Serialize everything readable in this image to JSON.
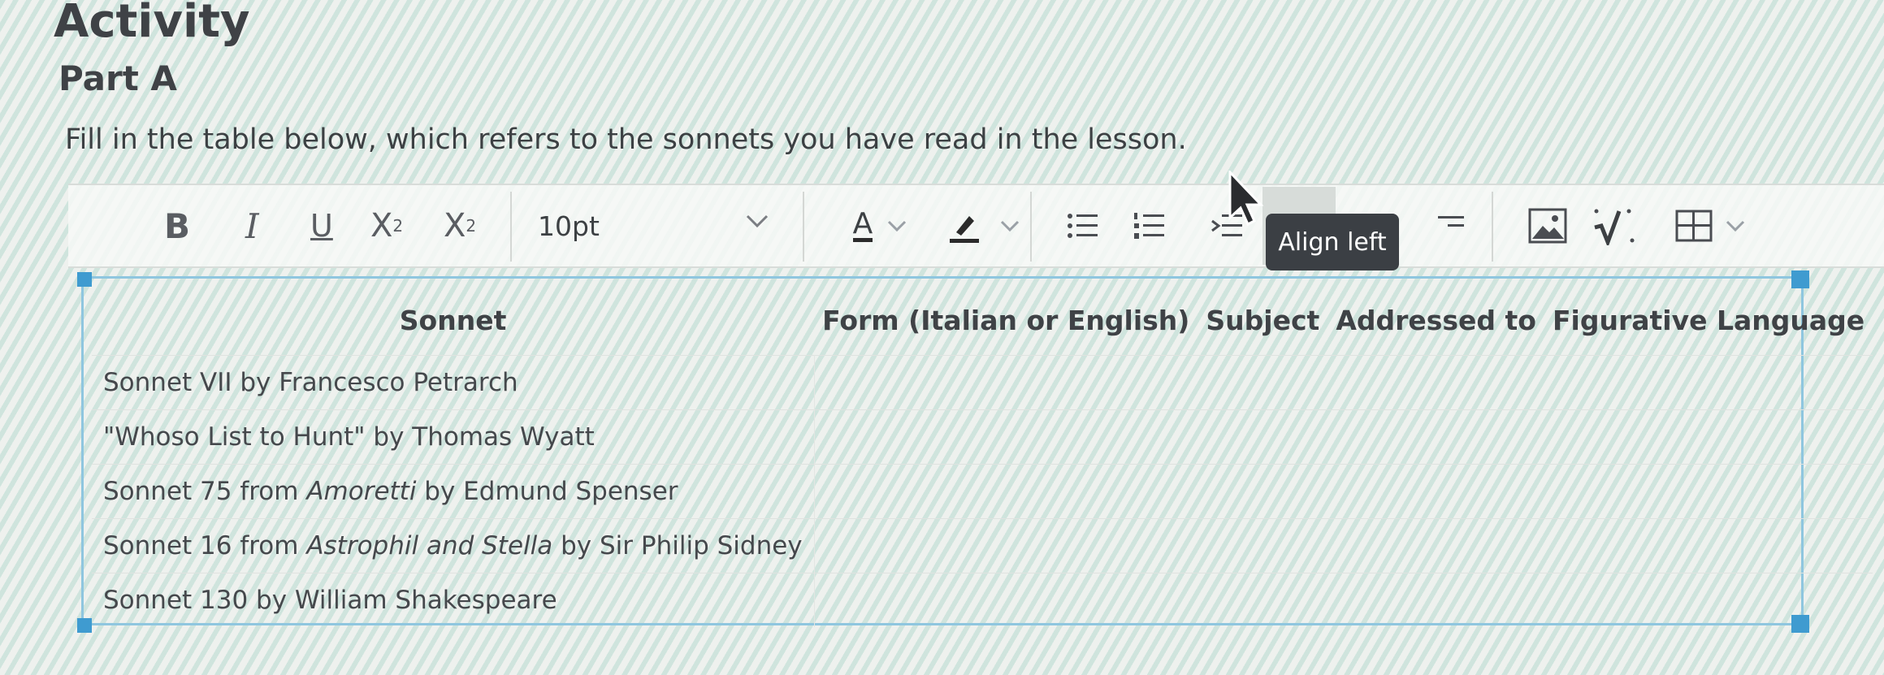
{
  "page": {
    "title": "Activity",
    "part": "Part A",
    "instructions": "Fill in the table below, which refers to the sonnets you have read in the lesson."
  },
  "toolbar": {
    "bold_label": "B",
    "italic_label": "I",
    "underline_label": "U",
    "superscript_label": "X",
    "superscript_mark": "2",
    "subscript_label": "X",
    "subscript_mark": "2",
    "font_size": "10pt",
    "text_color_label": "A",
    "tooltip": "Align left",
    "icons": [
      "bold",
      "italic",
      "underline",
      "superscript",
      "subscript",
      "chevron-down-icon",
      "text-color-icon",
      "highlight-icon",
      "bullet-list-icon",
      "numbered-list-icon",
      "indent-icon",
      "align-left-icon",
      "align-center-icon",
      "align-right-icon",
      "image-icon",
      "math-icon",
      "table-icon"
    ]
  },
  "table": {
    "headers": [
      "Sonnet",
      "Form (Italian or English)",
      "Subject",
      "Addressed to",
      "Figurative Language"
    ],
    "rows": [
      {
        "pre": "Sonnet VII by Francesco Petrarch",
        "em": "",
        "post": ""
      },
      {
        "pre": "\"Whoso List to Hunt\" by Thomas Wyatt",
        "em": "",
        "post": ""
      },
      {
        "pre": "Sonnet 75 from ",
        "em": "Amoretti",
        "post": " by Edmund Spenser"
      },
      {
        "pre": "Sonnet 16 from ",
        "em": "Astrophil and Stella",
        "post": " by Sir Philip Sidney"
      },
      {
        "pre": "Sonnet 130 by William Shakespeare",
        "em": "",
        "post": ""
      }
    ]
  },
  "colors": {
    "accent": "#3f9bd0",
    "tooltip_bg": "#3b3f44",
    "text_color_bar": "#2b2b2b"
  }
}
